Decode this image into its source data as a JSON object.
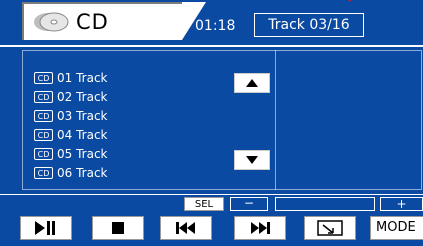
{
  "header": {
    "source": "CD",
    "time": "01:18",
    "track": "Track 03/16"
  },
  "list": {
    "badge": "CD",
    "items": [
      "01 Track",
      "02 Track",
      "03 Track",
      "04 Track",
      "05 Track",
      "06 Track"
    ]
  },
  "adjust": {
    "sel": "SEL",
    "minus": "−",
    "plus": "+"
  },
  "controls": {
    "mode": "MODE"
  },
  "icons": [
    "cd-disc-icon",
    "scroll-up-icon",
    "scroll-down-icon",
    "play-pause-icon",
    "stop-icon",
    "previous-track-icon",
    "next-track-icon",
    "menu-icon"
  ],
  "colors": {
    "background": "#0a4aa3",
    "button": "#ffffff",
    "text": "#ffffff",
    "accent_line": "#e11111"
  }
}
